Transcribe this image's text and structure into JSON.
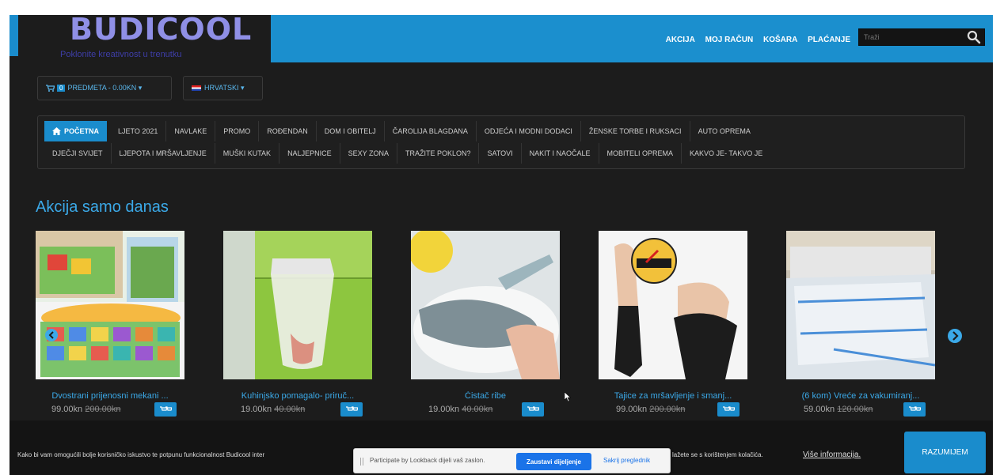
{
  "brand": {
    "logo_text": "BUDICOOL",
    "tagline": "Poklonite kreativnost u trenutku"
  },
  "top_nav": {
    "items": [
      "AKCIJA",
      "MOJ RAČUN",
      "KOŠARA",
      "PLAĆANJE"
    ]
  },
  "search": {
    "placeholder": "Traži"
  },
  "cart_pill": {
    "count": "0",
    "label": "PREDMETA - 0.00KN ▾"
  },
  "language_pill": {
    "label": "HRVATSKI ▾"
  },
  "categories": {
    "row1": [
      "POČETNA",
      "LJETO 2021",
      "NAVLAKE",
      "PROMO",
      "ROĐENDAN",
      "DOM I OBITELJ",
      "ČAROLIJA BLAGDANA",
      "ODJEĆA I MODNI DODACI",
      "ŽENSKE TORBE I RUKSACI",
      "AUTO OPREMA"
    ],
    "row2": [
      "DJEČJI SVIJET",
      "LJEPOTA I MRŠAVLJENJE",
      "MUŠKI KUTAK",
      "NALJEPNICE",
      "SEXY ZONA",
      "TRAŽITE POKLON?",
      "SATOVI",
      "NAKIT I NAOČALE",
      "MOBITELI OPREMA",
      "KAKVO JE- TAKVO JE"
    ]
  },
  "section": {
    "title": "Akcija samo danas"
  },
  "products": [
    {
      "name": "Dvostrani prijenosni mekani ...",
      "price": "99.00kn",
      "old_price": "200.00kn"
    },
    {
      "name": "Kuhinjsko pomagalo- priruč...",
      "price": "19.00kn",
      "old_price": "40.00kn"
    },
    {
      "name": "Čistač ribe",
      "price": "19.00kn",
      "old_price": "40.00kn"
    },
    {
      "name": "Tajice za mršavljenje i smanj...",
      "price": "99.00kn",
      "old_price": "200.00kn"
    },
    {
      "name": "(6 kom) Vreće za vakumiranj...",
      "price": "59.00kn",
      "old_price": "120.00kn"
    }
  ],
  "cookie": {
    "text_left": "Kako bi vam omogućili bolje korisničko iskustvo te potpunu funkcionalnost Budicool inter",
    "text_right": "lažete se s korištenjem kolačića.",
    "more_info": "Više informacija.",
    "accept": "RAZUMIJEM"
  },
  "share_bar": {
    "text": "Participate by Lookback dijeli vaš zaslon.",
    "stop": "Zaustavi dijeljenje",
    "hide": "Sakrij preglednik"
  },
  "colors": {
    "accent": "#1a8ccc",
    "link": "#3ba9e8",
    "background": "#1c1c1c"
  }
}
